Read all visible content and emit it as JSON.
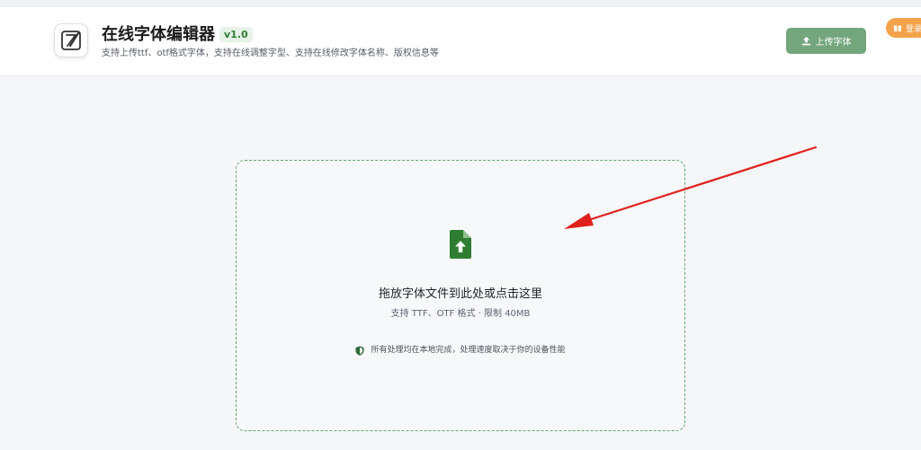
{
  "app": {
    "title": "在线字体编辑器",
    "version": "v1.0",
    "subtitle": "支持上传ttf、otf格式字体，支持在线调整字型、支持在线修改字体名称、版权信息等"
  },
  "header": {
    "upload_button_label": "上传字体",
    "login_label": "登录"
  },
  "dropzone": {
    "title": "拖放字体文件到此处或点击这里",
    "formats": "支持 TTF、OTF 格式 · 限制 40MB",
    "privacy_note": "所有处理均在本地完成，处理速度取决于你的设备性能"
  },
  "icons": [
    "logo-edit-icon",
    "upload-icon",
    "gift-icon",
    "file-upload-icon",
    "shield-icon"
  ],
  "colors": {
    "accent_green": "#2e7d32",
    "button_green": "#74a67e",
    "login_orange": "#f4a24a",
    "annotation_red": "#e0201b"
  }
}
